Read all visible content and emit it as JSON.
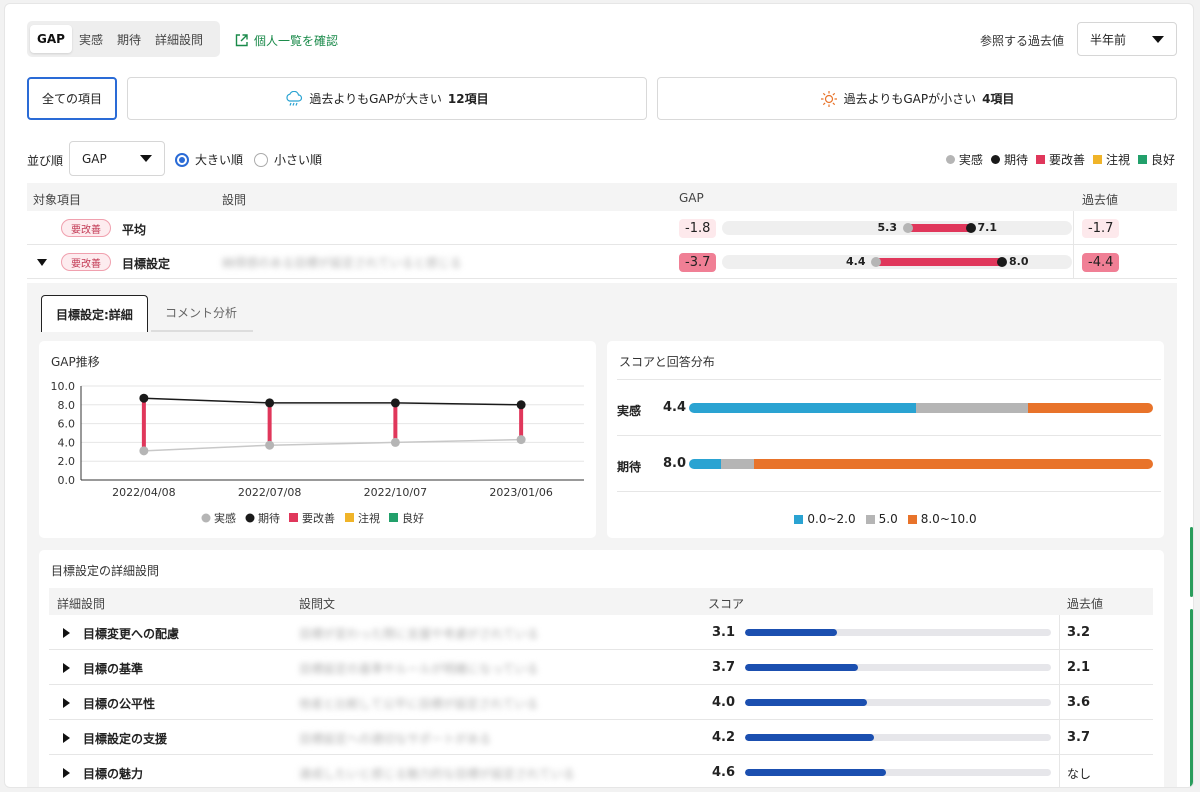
{
  "tabs": [
    "GAP",
    "実感",
    "期待",
    "詳細設問"
  ],
  "external_link": "個人一覧を確認",
  "reference": {
    "label": "参照する過去値",
    "value": "半年前"
  },
  "filters": {
    "all": "全ての項目",
    "larger": {
      "label": "過去よりもGAPが大きい",
      "count": "12項目"
    },
    "smaller": {
      "label": "過去よりもGAPが小さい",
      "count": "4項目"
    }
  },
  "sort": {
    "label": "並び順",
    "value": "GAP",
    "radios": [
      "大きい順",
      "小さい順"
    ]
  },
  "legend": [
    {
      "label": "実感",
      "color": "#b5b5b5",
      "shape": "dot"
    },
    {
      "label": "期待",
      "color": "#1a1a1a",
      "shape": "dot"
    },
    {
      "label": "要改善",
      "color": "#e0375b",
      "shape": "square"
    },
    {
      "label": "注視",
      "color": "#f0b429",
      "shape": "square"
    },
    {
      "label": "良好",
      "color": "#22a06b",
      "shape": "square"
    }
  ],
  "table": {
    "headers": [
      "対象項目",
      "設問",
      "GAP",
      "過去値"
    ],
    "rows": [
      {
        "badge": "要改善",
        "label": "平均",
        "question": "",
        "gap": "-1.8",
        "jikkan": 5.3,
        "kitai": 7.1,
        "jikkan_label": "5.3",
        "kitai_label": "7.1",
        "past": "-1.7"
      },
      {
        "badge": "要改善",
        "label": "目標設定",
        "question": "納得感のある目標が設定されていると感じる",
        "gap": "-3.7",
        "jikkan": 4.4,
        "kitai": 8.0,
        "jikkan_label": "4.4",
        "kitai_label": "8.0",
        "past": "-4.4"
      }
    ]
  },
  "detail_tabs": [
    "目標設定:詳細",
    "コメント分析"
  ],
  "gap_trend": {
    "title": "GAP推移"
  },
  "chart_data": {
    "type": "line",
    "categories": [
      "2022/04/08",
      "2022/07/08",
      "2022/10/07",
      "2023/01/06"
    ],
    "series": [
      {
        "name": "実感",
        "values": [
          3.1,
          3.7,
          4.0,
          4.3
        ]
      },
      {
        "name": "期待",
        "values": [
          8.7,
          8.2,
          8.2,
          8.0
        ]
      }
    ],
    "y_ticks": [
      "10.0",
      "8.0",
      "6.0",
      "4.0",
      "2.0",
      "0.0"
    ],
    "ylim": [
      0,
      10
    ],
    "legend": [
      "実感",
      "期待",
      "要改善",
      "注視",
      "良好"
    ],
    "grid": true
  },
  "score_dist": {
    "title": "スコアと回答分布",
    "rows": [
      {
        "label": "実感",
        "value": "4.4",
        "segments": [
          49,
          24,
          27
        ]
      },
      {
        "label": "期待",
        "value": "8.0",
        "segments": [
          7,
          7,
          86
        ]
      }
    ],
    "legend": [
      {
        "label": "0.0~2.0",
        "color": "#2aa3d2"
      },
      {
        "label": "5.0",
        "color": "#b5b5b5"
      },
      {
        "label": "8.0~10.0",
        "color": "#e8732a"
      }
    ]
  },
  "details": {
    "title": "目標設定の詳細設問",
    "headers": [
      "詳細設問",
      "設問文",
      "スコア",
      "過去値"
    ],
    "rows": [
      {
        "label": "目標変更への配慮",
        "question": "目標が変わった際に支援や考慮がされている",
        "score": "3.1",
        "pct": 30,
        "past": "3.2"
      },
      {
        "label": "目標の基準",
        "question": "目標設定の基準やルールが明確になっている",
        "score": "3.7",
        "pct": 37,
        "past": "2.1"
      },
      {
        "label": "目標の公平性",
        "question": "他者と比較して公平に目標が設定されている",
        "score": "4.0",
        "pct": 40,
        "past": "3.6"
      },
      {
        "label": "目標設定の支援",
        "question": "目標設定への適切なサポートがある",
        "score": "4.2",
        "pct": 42,
        "past": "3.7"
      },
      {
        "label": "目標の魅力",
        "question": "達成したいと感じる魅力的な目標が設定されている",
        "score": "4.6",
        "pct": 46,
        "past": "なし"
      }
    ]
  }
}
